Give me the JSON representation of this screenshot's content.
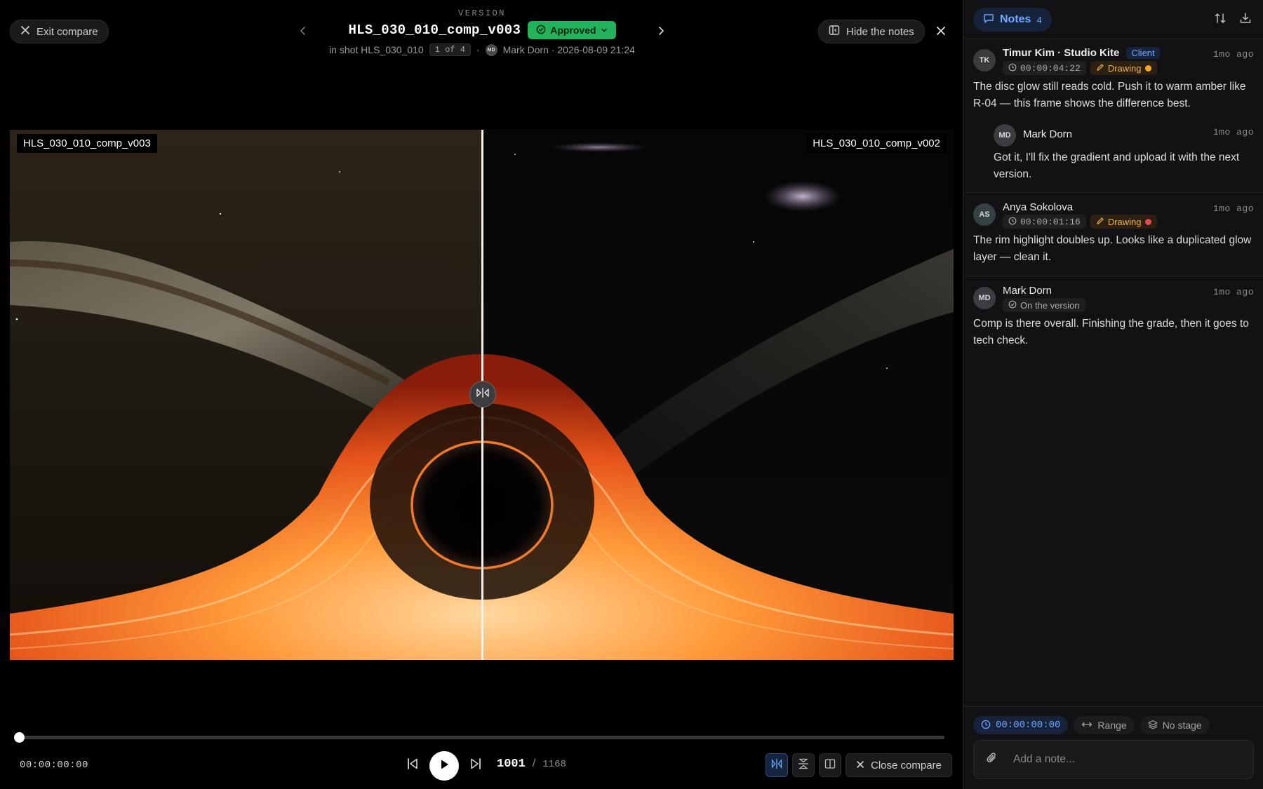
{
  "header": {
    "exit_compare_label": "Exit compare",
    "version_kicker": "VERSION",
    "version_title": "HLS_030_010_comp_v003",
    "status_label": "Approved",
    "shot_text": "in shot HLS_030_010",
    "version_counter": "1 of 4",
    "author_initials": "MD",
    "author_meta": "Mark Dorn · 2026-08-09 21:24",
    "hide_notes_label": "Hide the notes",
    "status_color": "#22b25a"
  },
  "compare": {
    "left_label": "HLS_030_010_comp_v003",
    "right_label": "HLS_030_010_comp_v002",
    "split_position": 0.5
  },
  "player": {
    "timecode": "00:00:00:00",
    "current_frame": "1001",
    "frame_separator": "/",
    "total_frames": "1168",
    "progress": 0.0,
    "close_compare_label": "Close compare"
  },
  "notes": {
    "tab_label": "Notes",
    "count": "4",
    "items": [
      {
        "initials": "TK",
        "author": "Timur Kim · Studio Kite",
        "role": "Client",
        "time_ago": "1mo ago",
        "timecode": "00:00:04:22",
        "drawing_label": "Drawing",
        "drawing_color": "#f5a623",
        "body": "The disc glow still reads cold. Push it to warm amber like R-04 — this frame shows the difference best.",
        "reply": {
          "initials": "MD",
          "author": "Mark Dorn",
          "time_ago": "1mo ago",
          "body": "Got it, I'll fix the gradient and upload it with the next version."
        }
      },
      {
        "initials": "AS",
        "author": "Anya Sokolova",
        "time_ago": "1mo ago",
        "timecode": "00:00:01:16",
        "drawing_label": "Drawing",
        "drawing_color": "#e5484d",
        "body": "The rim highlight doubles up. Looks like a duplicated glow layer — clean it."
      },
      {
        "initials": "MD",
        "author": "Mark Dorn",
        "time_ago": "1mo ago",
        "scope_label": "On the version",
        "body": "Comp is there overall. Finishing the grade, then it goes to tech check."
      }
    ]
  },
  "composer": {
    "timecode": "00:00:00:00",
    "range_label": "Range",
    "stage_label": "No stage",
    "placeholder": "Add a note..."
  }
}
